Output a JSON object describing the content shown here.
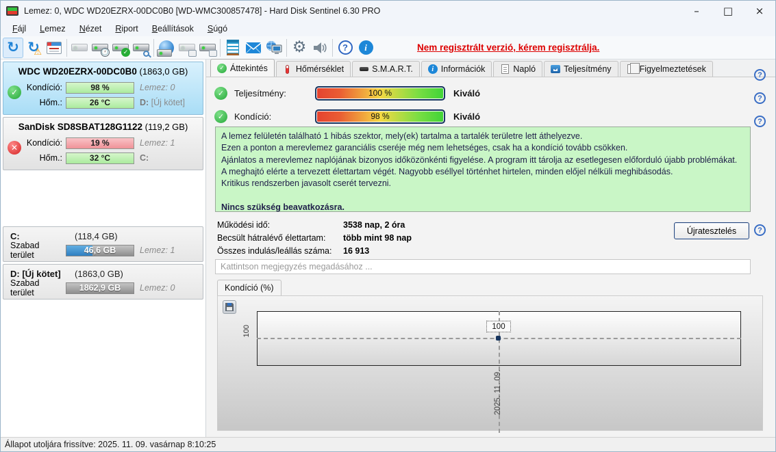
{
  "window": {
    "title": "Lemez: 0, WDC WD20EZRX-00DC0B0 [WD-WMC300857478]  -  Hard Disk Sentinel 6.30 PRO",
    "controls": {
      "minimize": "–",
      "maximize": "□",
      "close": "×"
    }
  },
  "menu": {
    "items": [
      {
        "hotkey": "F",
        "rest": "ájl"
      },
      {
        "hotkey": "L",
        "rest": "emez"
      },
      {
        "hotkey": "N",
        "rest": "ézet"
      },
      {
        "hotkey": "R",
        "rest": "iport"
      },
      {
        "hotkey": "B",
        "rest": "eállítások"
      },
      {
        "hotkey": "S",
        "rest": "úgó"
      }
    ]
  },
  "toolbar": {
    "icons": [
      "refresh-icon",
      "refresh-warning-icon",
      "report-window-icon",
      "disk-offline-icon",
      "disk-clock-icon",
      "disk-check-icon",
      "disk-search-icon",
      "network-disk-icon",
      "disk-eject-icon",
      "disk-plug-icon",
      "log-notepad-icon",
      "mail-icon",
      "remote-monitor-icon",
      "settings-gear-icon",
      "sound-icon",
      "help-icon",
      "info-icon"
    ],
    "unregistered_text": "Nem regisztrált verzió, kérem regisztrálja.",
    "register_color": "#dd0000"
  },
  "sidebar": {
    "disks": [
      {
        "name": "WDC WD20EZRX-00DC0B0",
        "size": "(1863,0 GB)",
        "condition_label": "Kondíció:",
        "condition_value": "98 %",
        "condition_percent": 98,
        "temp_label": "Hőm.:",
        "temp_value": "26 °C",
        "disk_label": "Lemez: 0",
        "volume_drive": "D:",
        "volume_name": " [Új kötet]",
        "status": "ok"
      },
      {
        "name": "SanDisk SD8SBAT128G1122",
        "size": "(119,2 GB)",
        "condition_label": "Kondíció:",
        "condition_value": "19 %",
        "condition_percent": 19,
        "temp_label": "Hőm.:",
        "temp_value": "32 °C",
        "disk_label": "Lemez: 1",
        "volume_drive": "C:",
        "volume_name": "",
        "status": "error"
      }
    ],
    "partitions": [
      {
        "name": "C:",
        "size": "(118,4 GB)",
        "free_label": "Szabad terület",
        "free_value": "46,6 GB",
        "fill_percent": 39,
        "disk_label": "Lemez: 1"
      },
      {
        "name": "D: [Új kötet]",
        "size": "(1863,0 GB)",
        "free_label": "Szabad terület",
        "free_value": "1862,9 GB",
        "fill_percent": 0,
        "disk_label": "Lemez: 0"
      }
    ]
  },
  "tabs": [
    {
      "label": "Áttekintés"
    },
    {
      "label": "Hőmérséklet"
    },
    {
      "label": "S.M.A.R.T."
    },
    {
      "label": "Információk"
    },
    {
      "label": "Napló"
    },
    {
      "label": "Teljesítmény"
    },
    {
      "label": "Figyelmeztetések"
    }
  ],
  "overview": {
    "performance": {
      "label": "Teljesítmény:",
      "value": "100 %",
      "percent": 100,
      "rating": "Kiváló"
    },
    "condition": {
      "label": "Kondíció:",
      "value": "98 %",
      "percent": 98,
      "rating": "Kiváló"
    },
    "message": {
      "lines": [
        "A lemez felületén található 1 hibás szektor, mely(ek) tartalma a tartalék területre lett áthelyezve.",
        "Ezen a ponton a merevlemez garanciális cseréje még nem lehetséges, csak ha a kondíció tovább csökken.",
        "Ajánlatos a merevlemez naplójának bizonyos időközönkénti figyelése. A program itt tárolja az esetlegesen előforduló újabb problémákat.",
        "A meghajtó elérte a tervezett élettartam végét. Nagyobb eséllyel történhet hirtelen, minden előjel nélküli meghibásodás.",
        "Kritikus rendszerben javasolt cserét tervezni."
      ],
      "bold_line": "Nincs szükség beavatkozásra.",
      "background": "#c9f6c6"
    },
    "stats": [
      {
        "label": "Működési idő:",
        "value": "3538 nap, 2 óra"
      },
      {
        "label": "Becsült hátralévő élettartam:",
        "value": "több mint 98 nap"
      },
      {
        "label": "Összes indulás/leállás száma:",
        "value": "16 913"
      }
    ],
    "retest_button": "Újratesztelés",
    "comment_placeholder": "Kattintson megjegyzés megadásához ..."
  },
  "chart_data": {
    "type": "line",
    "title": "Kondíció  (%)",
    "x": [
      "2025. 11. 09."
    ],
    "values": [
      100
    ],
    "series": [
      {
        "name": "Kondíció (%)",
        "values": [
          100
        ]
      }
    ],
    "point_label": "100",
    "ytick": "100",
    "xtick": "2025. 11. 09.",
    "ylim": [
      0,
      120
    ],
    "grid": "dashed-crosshair",
    "legend_position": "none"
  },
  "statusbar": {
    "text": "Állapot utoljára frissítve: 2025. 11. 09. vasárnap 8:10:25"
  },
  "colors": {
    "accent_blue": "#1e82d6",
    "selected_disk_bg": "#a9ddf6",
    "bar_green": "#abeb9e",
    "bar_red": "#f09298",
    "grad_bar_border": "#17355f",
    "message_green": "#c9f6c6",
    "register_red": "#dd0000",
    "free_fill_blue": "#2f7fc1"
  }
}
